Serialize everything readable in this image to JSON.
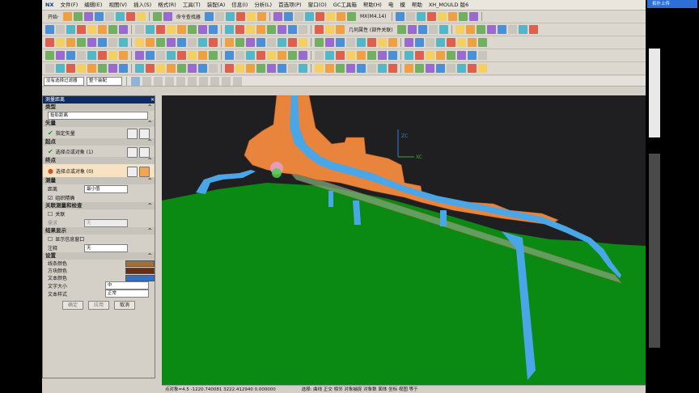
{
  "menubar": {
    "logo": "NX",
    "items": [
      "文件(F)",
      "编辑(E)",
      "视图(V)",
      "插入(S)",
      "格式(R)",
      "工具(T)",
      "装配(A)",
      "信息(I)",
      "分析(L)",
      "首选项(P)",
      "窗口(O)",
      "GC工具箱",
      "帮助(H)",
      "电",
      "模",
      "帮助",
      "XH_MOULD 版6"
    ]
  },
  "toolbar1": {
    "start_label": "开始·",
    "command_finder": "命令查找器",
    "extra": "MX(M4.14)"
  },
  "toolbar2": {
    "text": "几何属性 (部件关联)"
  },
  "selbar": {
    "filter": "没有选择过滤器",
    "scope": "整个装配"
  },
  "panel": {
    "title": "测量距离",
    "type_section": "类型",
    "type_value": "投影距离",
    "vector_section": "矢量",
    "vector_label": "指定矢量",
    "start_section": "起点",
    "start_label": "选择点或对象 (1)",
    "end_section": "终点",
    "end_label": "选择点或对象 (0)",
    "measure_section": "测量",
    "distance_label": "距离",
    "distance_value": "最小值",
    "precise_label": "组织精确",
    "related_section": "关联测量和检查",
    "associative_label": "关联",
    "requirement_label": "需求",
    "requirement_value": "无",
    "result_section": "结果显示",
    "show_info_label": "显示信息窗口",
    "annotation_label": "注释",
    "annotation_value": "无",
    "settings_section": "设置",
    "line_color_label": "线条颜色",
    "force_color_label": "方块颜色",
    "text_color_label": "文本颜色",
    "text_size_label": "文字大小",
    "text_size_value": "中",
    "text_style_label": "文本样式",
    "text_style_value": "正常",
    "ok_label": "确定",
    "apply_label": "应用",
    "cancel_label": "取消",
    "colors": {
      "line": "#a0703c",
      "force": "#6a2d14",
      "text": "#3370c6"
    }
  },
  "view": {
    "axis_z": "ZC",
    "axis_x": "XC",
    "colors": {
      "background": "#1f1f22",
      "ground": "#0a8a12",
      "part": "#e8843c",
      "channel": "#4aa6e6"
    }
  },
  "status": {
    "text": "点对象=4.5  -1220.740081  3222.412940  0.000000",
    "right_text": "选择: 曲线 正交 相邻  对象捕捉  对象数 面体 坐标 视图 等于"
  },
  "sidebar": {
    "badge": "拓扑上传"
  }
}
